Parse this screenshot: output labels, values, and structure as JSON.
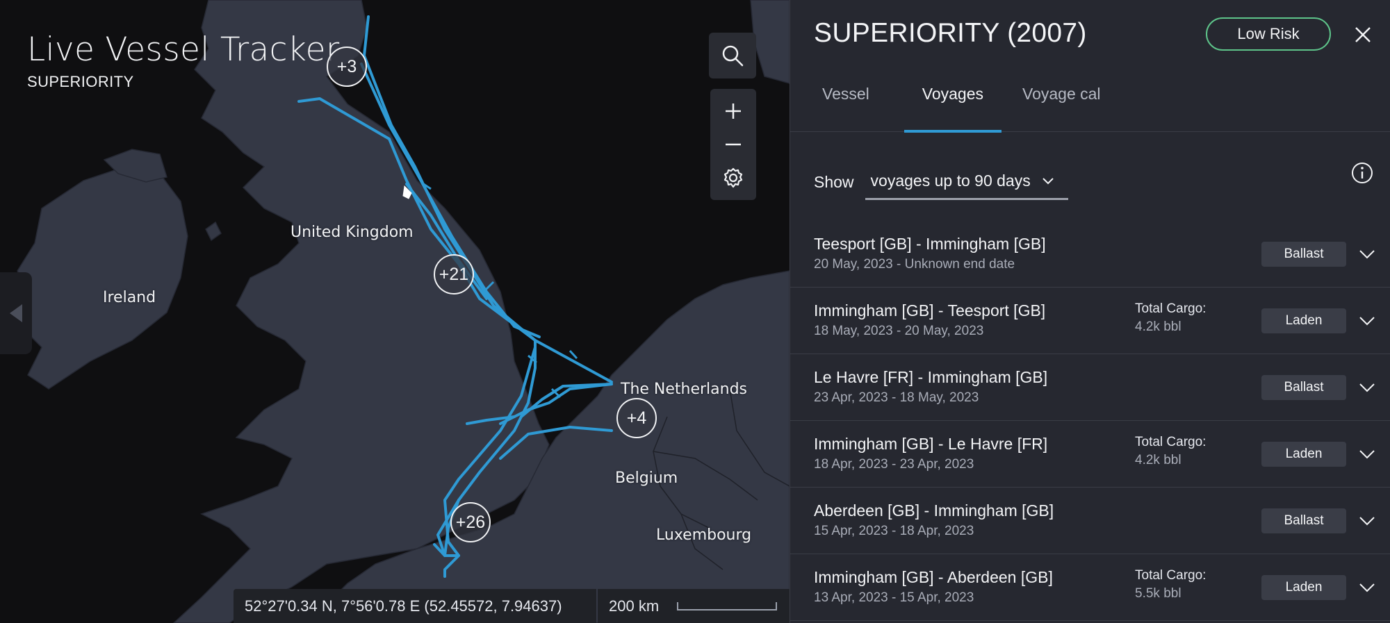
{
  "map": {
    "title": "Live Vessel Tracker",
    "subtitle": "SUPERIORITY",
    "labels": {
      "uk": "United Kingdom",
      "ireland": "Ireland",
      "netherlands": "The Netherlands",
      "belgium": "Belgium",
      "luxembourg": "Luxembourg"
    },
    "clusters": [
      "+3",
      "+21",
      "+4",
      "+26"
    ],
    "coordinates": "52°27'0.34 N, 7°56'0.78 E (52.45572, 7.94637)",
    "scale_label": "200 km",
    "route_color": "#2f9ad4",
    "icons": [
      "search-icon",
      "zoom-in-icon",
      "zoom-out-icon",
      "settings-icon",
      "collapse-left-icon"
    ]
  },
  "panel": {
    "vessel_title": "SUPERIORITY (2007)",
    "risk_badge": "Low Risk",
    "risk_color": "#5ec48a",
    "tabs": [
      "Vessel",
      "Voyages",
      "Voyage cal"
    ],
    "active_tab": "Voyages",
    "filter_label": "Show",
    "filter_value": "voyages up to 90 days",
    "voyages": [
      {
        "route": "Teesport [GB] - Immingham [GB]",
        "dates": "20 May, 2023 - Unknown end date",
        "cargo_label": "",
        "cargo_value": "",
        "status": "Ballast"
      },
      {
        "route": "Immingham [GB] - Teesport [GB]",
        "dates": "18 May, 2023 - 20 May, 2023",
        "cargo_label": "Total Cargo:",
        "cargo_value": "4.2k bbl",
        "status": "Laden"
      },
      {
        "route": "Le Havre [FR] - Immingham [GB]",
        "dates": "23 Apr, 2023 - 18 May, 2023",
        "cargo_label": "",
        "cargo_value": "",
        "status": "Ballast"
      },
      {
        "route": "Immingham [GB] - Le Havre [FR]",
        "dates": "18 Apr, 2023 - 23 Apr, 2023",
        "cargo_label": "Total Cargo:",
        "cargo_value": "4.2k bbl",
        "status": "Laden"
      },
      {
        "route": "Aberdeen [GB] - Immingham [GB]",
        "dates": "15 Apr, 2023 - 18 Apr, 2023",
        "cargo_label": "",
        "cargo_value": "",
        "status": "Ballast"
      },
      {
        "route": "Immingham [GB] - Aberdeen [GB]",
        "dates": "13 Apr, 2023 - 15 Apr, 2023",
        "cargo_label": "Total Cargo:",
        "cargo_value": "5.5k bbl",
        "status": "Laden"
      }
    ]
  }
}
